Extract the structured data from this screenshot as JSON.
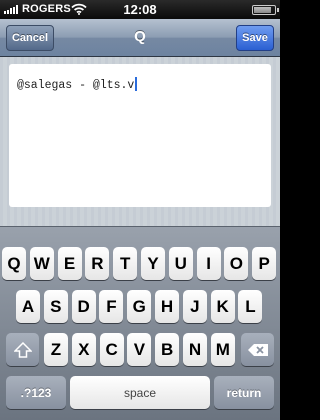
{
  "status_bar": {
    "carrier": "ROGERS",
    "time": "12:08",
    "battery_level": 0.85,
    "icons": [
      "signal-bars-icon",
      "wifi-icon",
      "battery-icon"
    ]
  },
  "nav_bar": {
    "cancel_label": "Cancel",
    "title": "Q",
    "save_label": "Save",
    "colors": {
      "nav_background": "#7f93ad",
      "save_button": "#2f63d4"
    }
  },
  "editor": {
    "text": "@salegas - @lts.v"
  },
  "keyboard": {
    "row1": [
      "Q",
      "W",
      "E",
      "R",
      "T",
      "Y",
      "U",
      "I",
      "O",
      "P"
    ],
    "row2": [
      "A",
      "S",
      "D",
      "F",
      "G",
      "H",
      "J",
      "K",
      "L"
    ],
    "row3": [
      "Z",
      "X",
      "C",
      "V",
      "B",
      "N",
      "M"
    ],
    "shift_icon": "shift-arrow-icon",
    "delete_icon": "backspace-icon",
    "numbers_label": ".?123",
    "space_label": "space",
    "return_label": "return"
  }
}
